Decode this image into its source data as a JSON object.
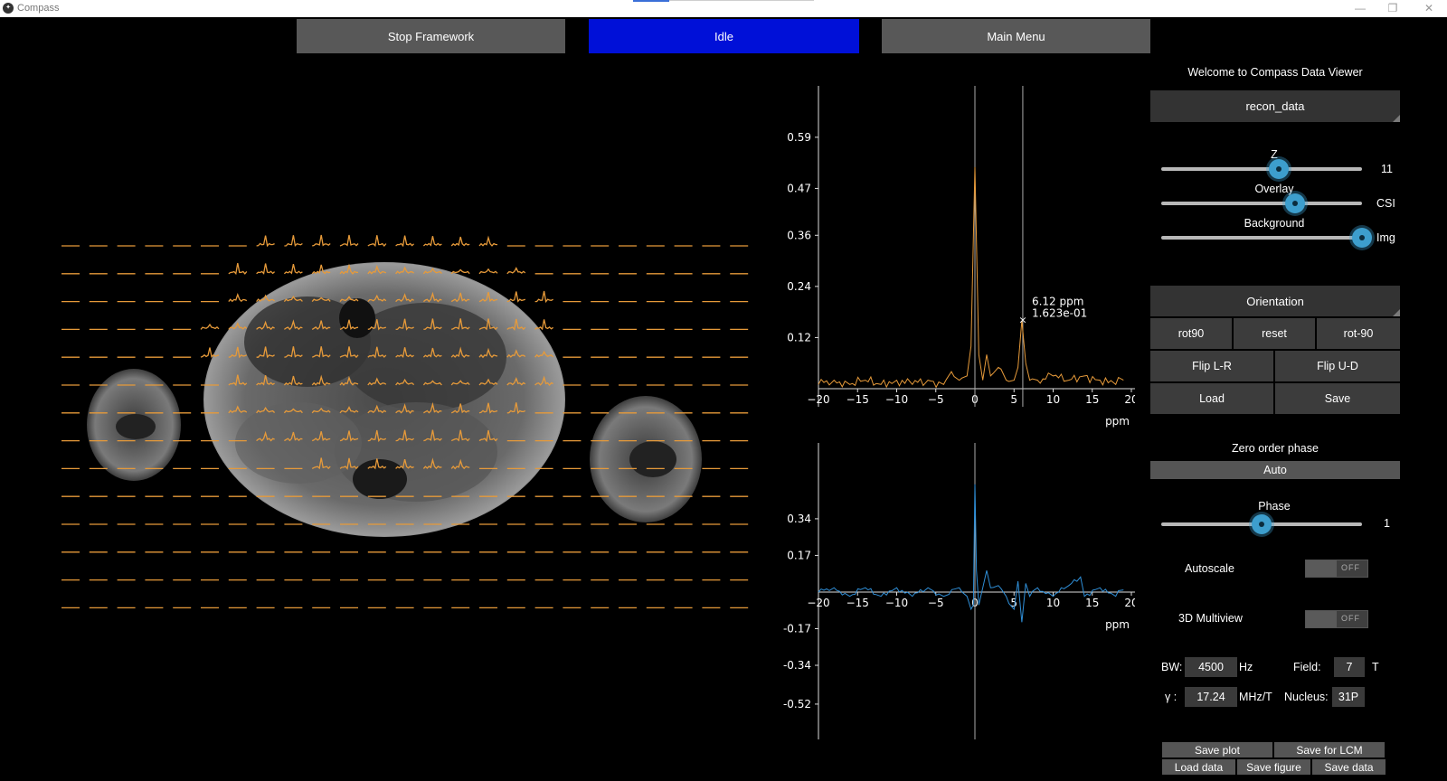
{
  "window": {
    "title": "Compass",
    "app_icon": "compass-app-icon",
    "minimize": "—",
    "maximize": "❐",
    "close": "✕"
  },
  "top": {
    "stop_label": "Stop Framework",
    "status_label": "Idle",
    "menu_label": "Main Menu",
    "status_color": "#0010d8"
  },
  "panel": {
    "welcome": "Welcome to Compass Data Viewer",
    "dataset": "recon_data",
    "z": {
      "label": "Z",
      "value": "11",
      "level": 0.59
    },
    "overlay": {
      "label": "Overlay",
      "value": "CSI",
      "level": 0.67
    },
    "background": {
      "label": "Background",
      "value": "Img",
      "level": 1.0
    },
    "orientation": "Orientation",
    "rot90": "rot90",
    "reset": "reset",
    "rotm90": "rot-90",
    "flip_lr": "Flip L-R",
    "flip_ud": "Flip U-D",
    "load": "Load",
    "save": "Save",
    "zero_order_phase": "Zero order phase",
    "auto": "Auto",
    "phase": {
      "label": "Phase",
      "value": "1",
      "level": 0.5
    },
    "autoscale": {
      "label": "Autoscale",
      "state": "OFF"
    },
    "multiview": {
      "label": "3D Multiview",
      "state": "OFF"
    },
    "bw_label": "BW:",
    "bw_value": "4500",
    "bw_unit": "Hz",
    "field_label": "Field:",
    "field_value": "7",
    "field_unit": "T",
    "gamma_label": "γ :",
    "gamma_value": "17.24",
    "gamma_unit": "MHz/T",
    "nucleus_label": "Nucleus:",
    "nucleus_value": "31P",
    "save_plot": "Save plot",
    "save_lcm": "Save for LCM",
    "load_data": "Load data",
    "save_figure": "Save figure",
    "save_data": "Save data"
  },
  "chart_data": [
    {
      "type": "line",
      "series": [
        {
          "color": "#e69a3a",
          "x": [
            -20,
            -18,
            -16,
            -14,
            -12,
            -10,
            -8,
            -6,
            -4,
            -3,
            -2,
            -1,
            -0.5,
            0,
            0.5,
            1,
            1.5,
            2,
            3,
            4,
            5,
            5.5,
            6,
            6.5,
            7,
            8,
            10,
            12,
            14,
            16,
            18,
            19
          ],
          "y": [
            0.01,
            0.02,
            0.01,
            0.02,
            0.01,
            0.02,
            0.01,
            0.02,
            0.01,
            0.04,
            0.02,
            0.03,
            0.1,
            0.52,
            0.08,
            0.02,
            0.08,
            0.03,
            0.05,
            0.02,
            0.02,
            0.05,
            0.16,
            0.06,
            0.02,
            0.02,
            0.03,
            0.02,
            0.03,
            0.02,
            0.01,
            0.02
          ]
        }
      ],
      "xticks": [
        "−20",
        "−15",
        "−10",
        "−5",
        "0",
        "5",
        "10",
        "15",
        "20"
      ],
      "yticks": [
        "0.12",
        "0.24",
        "0.36",
        "0.47",
        "0.59"
      ],
      "xlabel": "ppm",
      "annotation": {
        "line1": "6.12 ppm",
        "line2": "1.623e-01",
        "x": 6.12,
        "y": 0.1623
      },
      "cursor_lines": [
        0,
        6.12
      ],
      "xlim": [
        -20,
        20
      ],
      "ylim": [
        0,
        0.7
      ]
    },
    {
      "type": "line",
      "series": [
        {
          "color": "#2f8fd8",
          "x": [
            -20,
            -18,
            -16,
            -14,
            -12,
            -10,
            -8,
            -6,
            -4,
            -2,
            -1,
            -0.5,
            -0.2,
            0,
            0.2,
            0.5,
            1,
            1.5,
            2,
            3,
            4,
            5,
            5.5,
            6,
            6.5,
            7,
            8,
            10,
            12,
            13.5,
            14,
            16,
            18,
            19
          ],
          "y": [
            0.0,
            0.02,
            -0.02,
            0.02,
            -0.02,
            0.02,
            -0.02,
            0.02,
            -0.02,
            0.02,
            -0.02,
            -0.08,
            -0.06,
            0.5,
            0.1,
            -0.06,
            0.02,
            0.1,
            0.02,
            0.03,
            -0.02,
            -0.08,
            0.05,
            -0.14,
            0.04,
            -0.02,
            0.02,
            -0.02,
            0.03,
            0.07,
            -0.02,
            0.02,
            -0.02,
            0.01
          ]
        }
      ],
      "xticks": [
        "−20",
        "−15",
        "−10",
        "−5",
        "0",
        "5",
        "10",
        "15",
        "20"
      ],
      "yticks": [
        "-0.52",
        "-0.34",
        "-0.17",
        "0.17",
        "0.34"
      ],
      "xlabel": "ppm",
      "xlim": [
        -20,
        20
      ],
      "ylim": [
        -0.6,
        0.65
      ]
    }
  ]
}
